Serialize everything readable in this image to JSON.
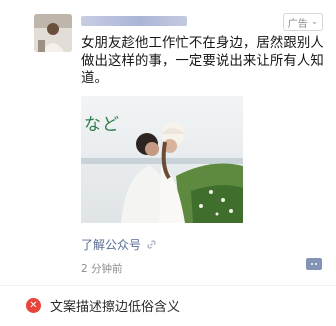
{
  "post": {
    "text": "女朋友趁他工作忙不在身边，居然跟别人做出这样的事，一定要说出来让所有人知道。",
    "ad_label": "广告",
    "image_overlay_text": "など",
    "follow_link_label": "了解公众号",
    "time": "2 分钟前"
  },
  "status": {
    "message": "文案描述擦边低俗含义"
  },
  "icons": {
    "ad_chevron": "chevron-down-icon",
    "link": "link-icon",
    "comment": "comment-icon",
    "error": "error-icon"
  },
  "colors": {
    "link": "#576b95",
    "error": "#e8443b",
    "comment_button": "#8594b4"
  }
}
